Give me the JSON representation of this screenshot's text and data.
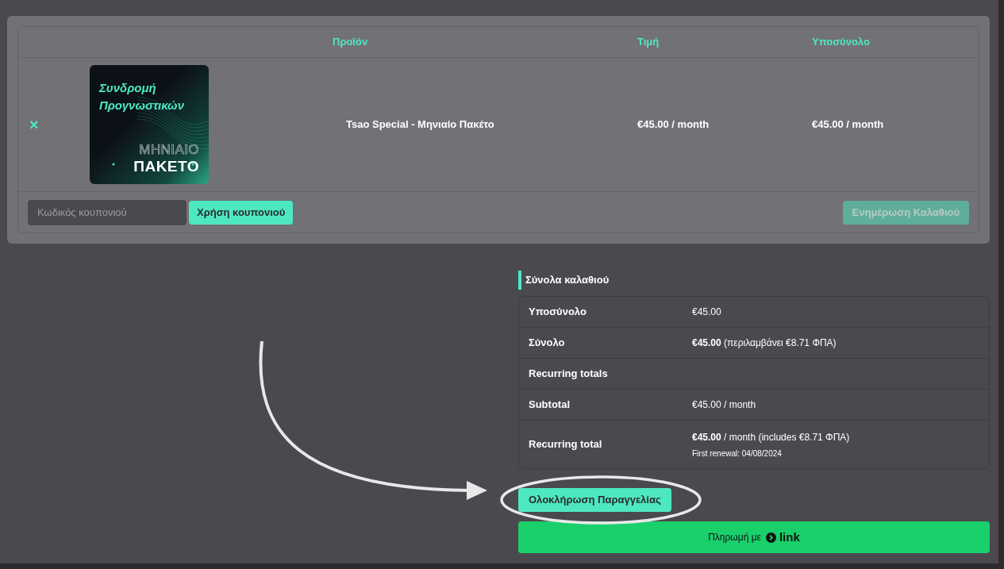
{
  "cart": {
    "columns": [
      "Προϊόν",
      "Τιμή",
      "Υποσύνολο"
    ],
    "rows": [
      {
        "remove": "×",
        "image_title": "Συνδρομή Προγνωστικών",
        "image_line_1": "ΜΗΝΙΑΙΟ",
        "image_line_2": "ΠΑΚΕΤΟ",
        "product": "Tsao Special - Μηνιαίο Πακέτο",
        "price": "€45.00 / month",
        "subtotal": "€45.00 / month"
      }
    ],
    "coupon": {
      "placeholder": "Κωδικός κουπονιού",
      "apply_button": "Χρήση κουπονιού"
    },
    "update_button": {
      "label": "Ενημέρωση Καλαθιού",
      "disabled": true
    }
  },
  "totals": {
    "title": "Σύνολα καλαθιού",
    "rows": [
      {
        "label": "Υποσύνολο",
        "value": "€45.00"
      },
      {
        "label": "Σύνολο",
        "value": "**€45.00** (περιλαμβάνει €8.71 ΦΠΑ)"
      },
      {
        "label": "Recurring totals"
      },
      {
        "label": "Subtotal",
        "value": "€45.00 / month"
      },
      {
        "label": "Recurring total",
        "value": "**€45.00** / month (includes €8.71 ΦΠΑ)",
        "note": "First renewal: 04/08/2024"
      }
    ]
  },
  "checkout_button": "Ολοκλήρωση Παραγγελίας",
  "link_button": {
    "prefix": "Πληρωμή με",
    "brand": "link"
  }
}
